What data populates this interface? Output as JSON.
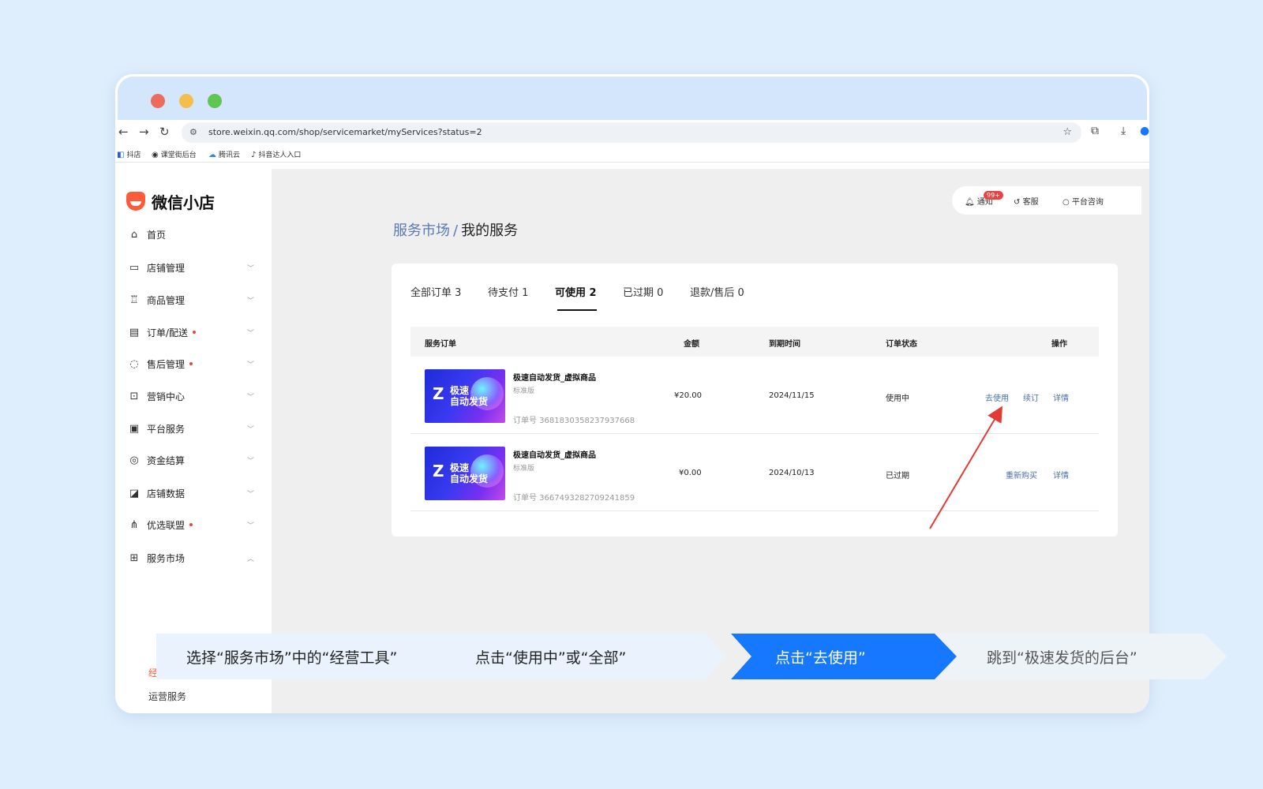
{
  "browser": {
    "url": "store.weixin.qq.com/shop/servicemarket/myServices?status=2",
    "bookmarks": [
      "抖店",
      "课堂街后台",
      "腾讯云",
      "抖音达人入口"
    ]
  },
  "sidebar": {
    "logo": "微信小店",
    "items": [
      {
        "label": "首页",
        "icon": "⌂",
        "dot": false,
        "chevron": ""
      },
      {
        "label": "店铺管理",
        "icon": "▭",
        "dot": false,
        "chevron": "﹀"
      },
      {
        "label": "商品管理",
        "icon": "♖",
        "dot": false,
        "chevron": "﹀"
      },
      {
        "label": "订单/配送",
        "icon": "▤",
        "dot": true,
        "chevron": "﹀"
      },
      {
        "label": "售后管理",
        "icon": "◌",
        "dot": true,
        "chevron": "﹀"
      },
      {
        "label": "营销中心",
        "icon": "⊡",
        "dot": false,
        "chevron": "﹀"
      },
      {
        "label": "平台服务",
        "icon": "▣",
        "dot": false,
        "chevron": "﹀"
      },
      {
        "label": "资金结算",
        "icon": "◎",
        "dot": false,
        "chevron": "﹀"
      },
      {
        "label": "店铺数据",
        "icon": "◪",
        "dot": false,
        "chevron": "﹀"
      },
      {
        "label": "优选联盟",
        "icon": "⋔",
        "dot": true,
        "chevron": "﹀"
      },
      {
        "label": "服务市场",
        "icon": "⊞",
        "dot": false,
        "chevron": "︿"
      }
    ],
    "sub_items": [
      "经营工具",
      "运营服务"
    ]
  },
  "topbar": {
    "notify": "通知",
    "notify_badge": "99+",
    "service": "客服",
    "consult": "平台咨询"
  },
  "breadcrumb": {
    "parent": "服务市场",
    "sep": "/",
    "current": "我的服务"
  },
  "tabs": [
    "全部订单 3",
    "待支付 1",
    "可使用 2",
    "已过期 0",
    "退款/售后 0"
  ],
  "active_tab": "可使用 2",
  "table": {
    "headers": [
      "服务订单",
      "金额",
      "到期时间",
      "订单状态",
      "操作"
    ],
    "rows": [
      {
        "name": "极速自动发货_虚拟商品",
        "spec": "标准版",
        "order": "订单号 3681830358237937668",
        "amount": "¥20.00",
        "expire": "2024/11/15",
        "status": "使用中",
        "ops": [
          "去使用",
          "续订",
          "详情"
        ]
      },
      {
        "name": "极速自动发货_虚拟商品",
        "spec": "标准版",
        "order": "订单号 3667493282709241859",
        "amount": "¥0.00",
        "expire": "2024/10/13",
        "status": "已过期",
        "ops": [
          "重新购买",
          "详情"
        ]
      }
    ],
    "thumb_text": [
      "极速",
      "自动发货"
    ]
  },
  "steps": [
    "选择“服务市场”中的“经营工具”",
    "点击“使用中”或“全部”",
    "点击“去使用”",
    "跳到“极速发货的后台”"
  ],
  "colors": {
    "accent": "#1677ff",
    "brand": "#ff5b3b",
    "arrow": "#e53935"
  }
}
